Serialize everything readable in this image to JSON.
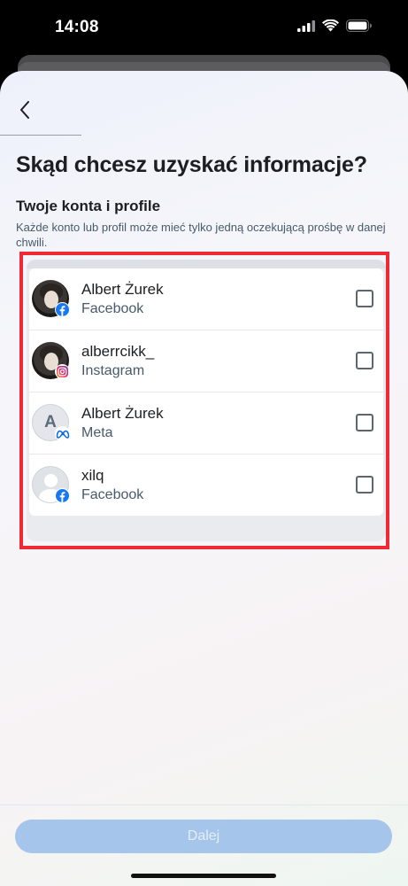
{
  "status_bar": {
    "time": "14:08"
  },
  "header": {
    "title": "Skąd chcesz uzyskać informacje?"
  },
  "section": {
    "title": "Twoje konta i profile",
    "description": "Każde konto lub profil może mieć tylko jedną oczekującą prośbę w danej chwili."
  },
  "accounts": [
    {
      "name": "Albert Żurek",
      "network": "Facebook",
      "badge": "facebook-icon"
    },
    {
      "name": "alberrcikk_",
      "network": "Instagram",
      "badge": "instagram-icon"
    },
    {
      "name": "Albert Żurek",
      "network": "Meta",
      "badge": "meta-icon",
      "avatar_letter": "A"
    },
    {
      "name": "xilq",
      "network": "Facebook",
      "badge": "facebook-icon"
    }
  ],
  "footer": {
    "next_label": "Dalej"
  },
  "colors": {
    "highlight": "#ee2a35",
    "button_disabled": "#a6c5ea",
    "facebook": "#1877f2"
  }
}
